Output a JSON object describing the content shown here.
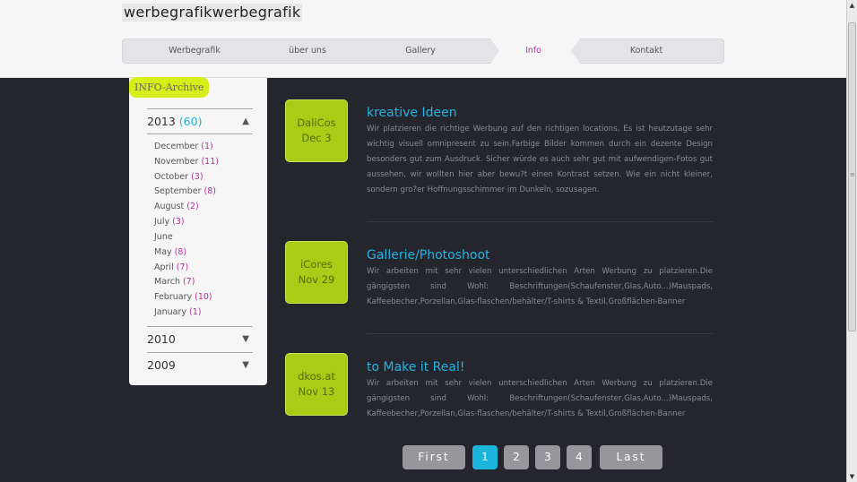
{
  "header": {
    "logo": "werbegrafikwerbegrafik"
  },
  "nav": {
    "items": [
      {
        "label": "Werbegrafik"
      },
      {
        "label": "über uns"
      },
      {
        "label": "Gallery"
      },
      {
        "label": "Info"
      },
      {
        "label": "Kontakt"
      }
    ],
    "active": "Info"
  },
  "sidebar": {
    "title": "INFO-Archive",
    "years": [
      {
        "year": "2013",
        "count": "(60)",
        "arrow": "▲"
      },
      {
        "year": "2010",
        "arrow": "▼"
      },
      {
        "year": "2009",
        "arrow": "▼"
      }
    ],
    "months": [
      {
        "name": "December",
        "count": "(1)"
      },
      {
        "name": "November",
        "count": "(11)"
      },
      {
        "name": "October",
        "count": "(3)"
      },
      {
        "name": "September",
        "count": "(8)"
      },
      {
        "name": "August",
        "count": "(2)"
      },
      {
        "name": "July",
        "count": "(3)"
      },
      {
        "name": "June",
        "count": ""
      },
      {
        "name": "May",
        "count": "(8)"
      },
      {
        "name": "April",
        "count": "(7)"
      },
      {
        "name": "March",
        "count": "(7)"
      },
      {
        "name": "February",
        "count": "(10)"
      },
      {
        "name": "January",
        "count": "(1)"
      }
    ]
  },
  "entries": [
    {
      "author": "DaliCos",
      "date": "Dec 3",
      "title": "kreative Ideen",
      "text": "Wir platzieren die richtige Werbung auf den richtigen locations. Es ist heutzutage sehr wichtig visuell omnipresent zu sein.Farbige Bilder kommen durch ein dezente Design besonders gut zum Ausdruck. Sicher würde es auch sehr gut mit aufwendigen-Fotos gut aussehen, wir wollten hier aber bewu?t einen Kontrast setzen. Wie ein nicht kleiner, sondern gro?er Hoffnungsschimmer im Dunkeln, sozusagen."
    },
    {
      "author": "iCores",
      "date": "Nov 29",
      "title": "Gallerie/Photoshoot",
      "text": "Wir arbeiten mit sehr vielen unterschiedlichen Arten Werbung zu platzieren.Die gängigsten sind Wohl: Beschriftungen(Schaufenster,Glas,Auto...)Mauspads, Kaffeebecher,Porzellan,Glas-flaschen/behälter/T-shirts & Textil,Großflächen-Banner"
    },
    {
      "author": "dkos.at",
      "date": "Nov 13",
      "title": "to Make it Real!",
      "text": "Wir arbeiten mit sehr vielen unterschiedlichen Arten Werbung zu platzieren.Die gängigsten sind Wohl: Beschriftungen(Schaufenster,Glas,Auto...)Mauspads, Kaffeebecher,Porzellan,Glas-flaschen/behälter/T-shirts & Textil,Großflächen-Banner"
    }
  ],
  "pagination": {
    "first": "First",
    "pages": [
      "1",
      "2",
      "3",
      "4"
    ],
    "current": "1",
    "last": "Last"
  },
  "colors": {
    "accent_blue": "#23b4e3",
    "accent_green": "#a9cc17",
    "accent_magenta": "#b0329a",
    "background": "#25252d"
  }
}
